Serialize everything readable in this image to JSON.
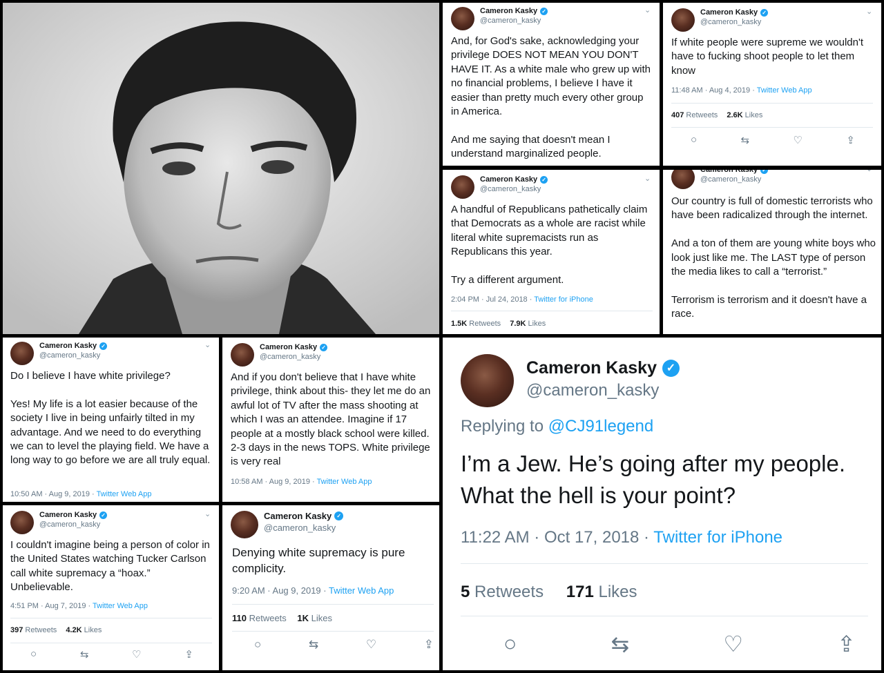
{
  "user": {
    "name": "Cameron Kasky",
    "handle": "@cameron_kasky",
    "verified_mark": "✓"
  },
  "icons": {
    "chevron": "chevron-down-icon",
    "reply": "reply-icon",
    "retweet": "retweet-icon",
    "like": "heart-icon",
    "share": "share-icon"
  },
  "colors": {
    "link": "#1da1f2",
    "muted": "#657786",
    "text": "#14171a"
  },
  "tweets": [
    {
      "body": "And, for God's sake, acknowledging your privilege DOES NOT MEAN YOU DON'T HAVE IT. As a white male who grew up with no financial problems, I believe I have it easier than pretty much every other group in America.\n\nAnd me saying that doesn't mean I understand marginalized people."
    },
    {
      "body": "If white people were supreme we wouldn't have to fucking shoot people to let them know",
      "time": "11:48 AM · Aug 4, 2019 · ",
      "source": "Twitter Web App",
      "retweets": "407",
      "retweets_label": " Retweets",
      "likes": "2.6K",
      "likes_label": " Likes"
    },
    {
      "body": "A handful of Republicans pathetically claim that Democrats as a whole are racist while literal white supremacists run as Republicans this year.\n\nTry a different argument.",
      "time": "2:04 PM · Jul 24, 2018 · ",
      "source": "Twitter for iPhone",
      "retweets": "1.5K",
      "retweets_label": " Retweets",
      "likes": "7.9K",
      "likes_label": " Likes"
    },
    {
      "body": "Our country is full of domestic terrorists who have been radicalized through the internet.\n\nAnd a ton of them are young white boys who look just like me. The LAST type of person the media likes to call a “terrorist.”\n\nTerrorism is terrorism and it doesn't have a race."
    },
    {
      "body": "Do I believe I have white privilege?\n\nYes! My life is a lot easier because of the society I live in being unfairly tilted in my advantage. And we need to do everything we can to level the playing field. We have a long way to go before we are all truly equal.",
      "time": "10:50 AM · Aug 9, 2019 · ",
      "source": "Twitter Web App"
    },
    {
      "body": "And if you don't believe that I have white privilege, think about this- they let me do an awful lot of TV after the mass shooting at which I was an attendee. Imagine if 17 people at a mostly black school were killed. 2-3 days in the news TOPS. White privilege is very real",
      "time": "10:58 AM · Aug 9, 2019 · ",
      "source": "Twitter Web App"
    },
    {
      "body": "I couldn't imagine being a person of color in the United States watching Tucker Carlson call white supremacy a “hoax.” Unbelievable.",
      "time": "4:51 PM · Aug 7, 2019 · ",
      "source": "Twitter Web App",
      "retweets": "397",
      "retweets_label": " Retweets",
      "likes": "4.2K",
      "likes_label": " Likes"
    },
    {
      "body": "Denying white supremacy is pure complicity.",
      "time": "9:20 AM · Aug 9, 2019 · ",
      "source": "Twitter Web App",
      "retweets": "110",
      "retweets_label": " Retweets",
      "likes": "1K",
      "likes_label": " Likes"
    },
    {
      "replying_label": "Replying to ",
      "replying_to": "@CJ91legend",
      "body": "I’m a Jew. He’s going after my people. What the hell is your point?",
      "time": "11:22 AM · Oct 17, 2018 · ",
      "source": "Twitter for iPhone",
      "retweets": "5",
      "retweets_label": " Retweets",
      "likes": "171",
      "likes_label": " Likes"
    }
  ]
}
